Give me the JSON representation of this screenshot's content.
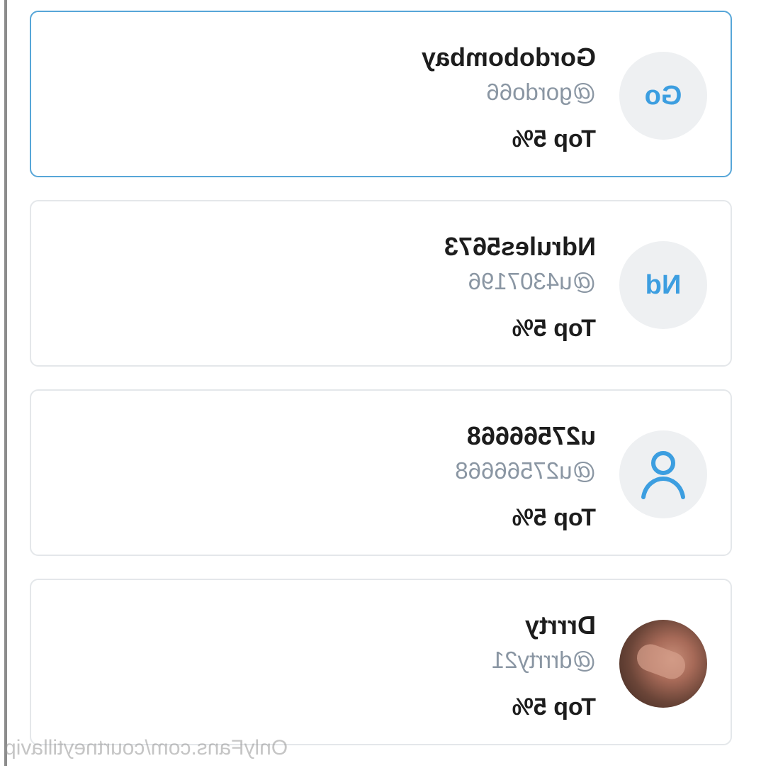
{
  "accent_color": "#3c9ee0",
  "selected_border_color": "#57a6d8",
  "fans": [
    {
      "name": "Gordobombay",
      "handle": "@gordo66",
      "rank": "Top 5%",
      "avatar_initials": "Go",
      "avatar_type": "initials",
      "selected": true
    },
    {
      "name": "Ndrules5673",
      "handle": "@u4307196",
      "rank": "Top 5%",
      "avatar_initials": "Nd",
      "avatar_type": "initials",
      "selected": false
    },
    {
      "name": "u27566668",
      "handle": "@u27566668",
      "rank": "Top 5%",
      "avatar_icon": "user-icon",
      "avatar_type": "icon",
      "selected": false
    },
    {
      "name": "Drrrty",
      "handle": "@drrrty21",
      "rank": "Top 5%",
      "avatar_type": "photo",
      "selected": false
    }
  ],
  "watermark": "OnlyFans.com/courtneytillavip"
}
